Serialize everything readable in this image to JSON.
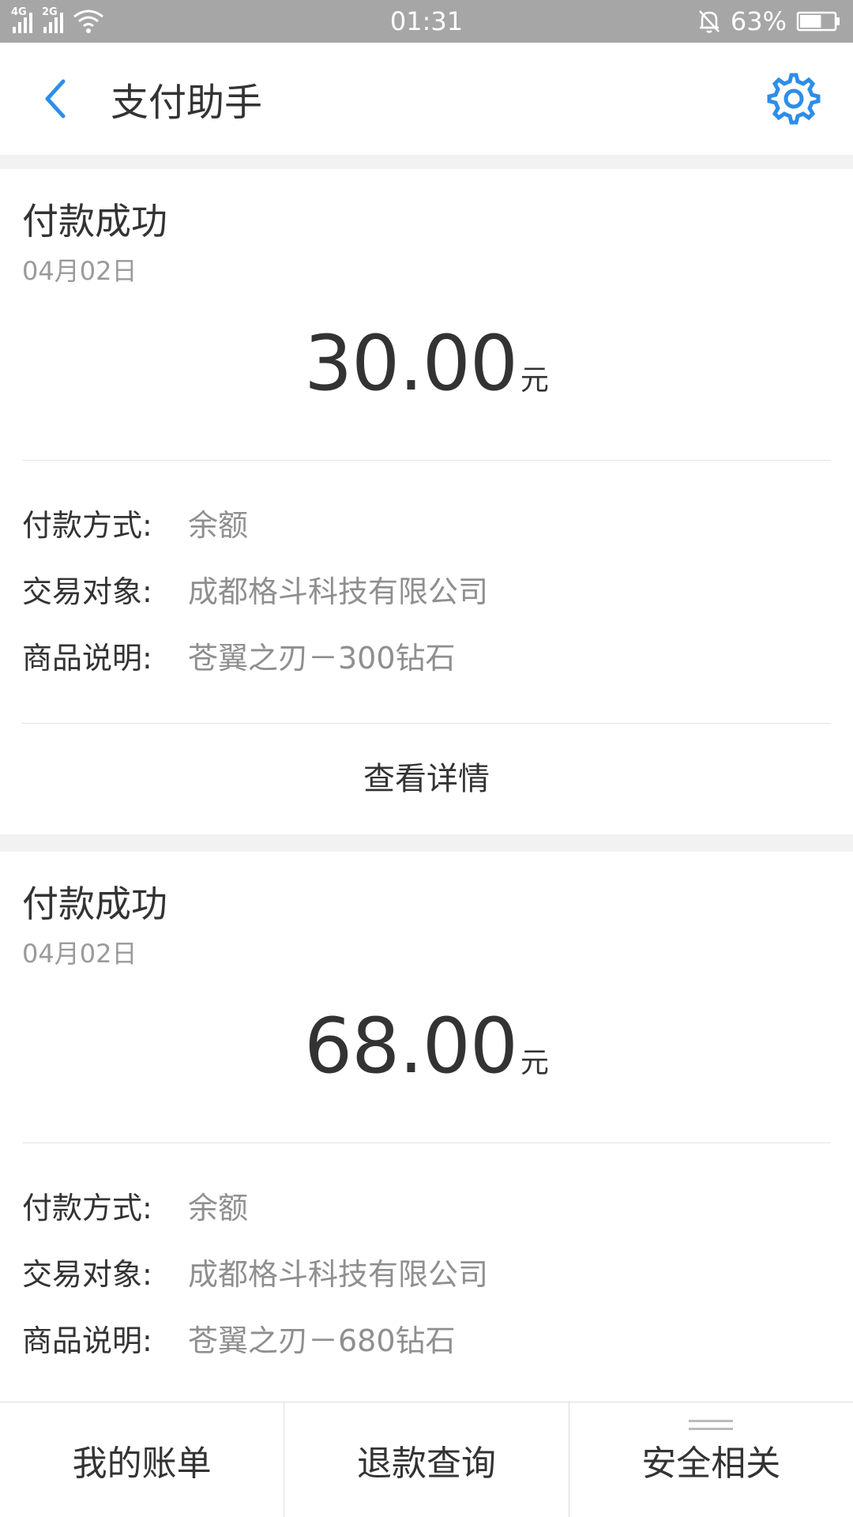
{
  "status_bar": {
    "net1": "4G",
    "net2": "2G",
    "time": "01:31",
    "battery": "63%",
    "battery_level": 0.63
  },
  "header": {
    "title": "支付助手",
    "accent_color": "#2d8ee8"
  },
  "cards": [
    {
      "title": "付款成功",
      "date": "04月02日",
      "amount": "30.00",
      "unit": "元",
      "details": [
        {
          "label": "付款方式:",
          "value": "余额"
        },
        {
          "label": "交易对象:",
          "value": "成都格斗科技有限公司"
        },
        {
          "label": "商品说明:",
          "value": "苍翼之刃－300钻石"
        }
      ],
      "link": "查看详情"
    },
    {
      "title": "付款成功",
      "date": "04月02日",
      "amount": "68.00",
      "unit": "元",
      "details": [
        {
          "label": "付款方式:",
          "value": "余额"
        },
        {
          "label": "交易对象:",
          "value": "成都格斗科技有限公司"
        },
        {
          "label": "商品说明:",
          "value": "苍翼之刃－680钻石"
        }
      ]
    }
  ],
  "bottom_nav": [
    {
      "label": "我的账单"
    },
    {
      "label": "退款查询"
    },
    {
      "label": "安全相关"
    }
  ]
}
